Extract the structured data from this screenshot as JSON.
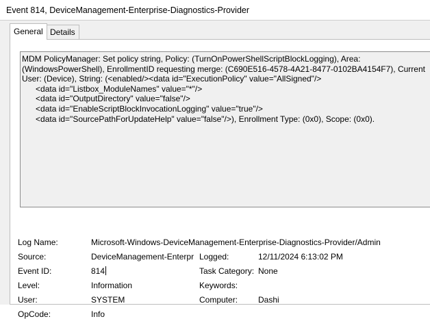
{
  "window": {
    "title": "Event 814, DeviceManagement-Enterprise-Diagnostics-Provider"
  },
  "tabs": [
    {
      "label": "General",
      "active": true
    },
    {
      "label": "Details",
      "active": false
    }
  ],
  "description": {
    "lines": [
      "MDM PolicyManager: Set policy string, Policy: (TurnOnPowerShellScriptBlockLogging), Area:",
      "(WindowsPowerShell), EnrollmentID requesting merge: (C690E516-4578-4A21-8477-0102BA4154F7), Current",
      "User: (Device), String: (<enabled/><data id=\"ExecutionPolicy\" value=\"AllSigned\"/>",
      "      <data id=\"Listbox_ModuleNames\" value=\"*\"/>",
      "      <data id=\"OutputDirectory\" value=\"false\"/>",
      "      <data id=\"EnableScriptBlockInvocationLogging\" value=\"true\"/>",
      "      <data id=\"SourcePathForUpdateHelp\" value=\"false\"/>), Enrollment Type: (0x0), Scope: (0x0)."
    ]
  },
  "fields": {
    "log_name_label": "Log Name:",
    "log_name_value": "Microsoft-Windows-DeviceManagement-Enterprise-Diagnostics-Provider/Admin",
    "source_label": "Source:",
    "source_value": "DeviceManagement-Enterpr",
    "logged_label": "Logged:",
    "logged_value": "12/11/2024 6:13:02 PM",
    "event_id_label": "Event ID:",
    "event_id_value": "814",
    "task_category_label": "Task Category:",
    "task_category_value": "None",
    "level_label": "Level:",
    "level_value": "Information",
    "keywords_label": "Keywords:",
    "keywords_value": "",
    "user_label": "User:",
    "user_value": "SYSTEM",
    "computer_label": "Computer:",
    "computer_value": "Dashi",
    "opcode_label": "OpCode:",
    "opcode_value": "Info"
  }
}
